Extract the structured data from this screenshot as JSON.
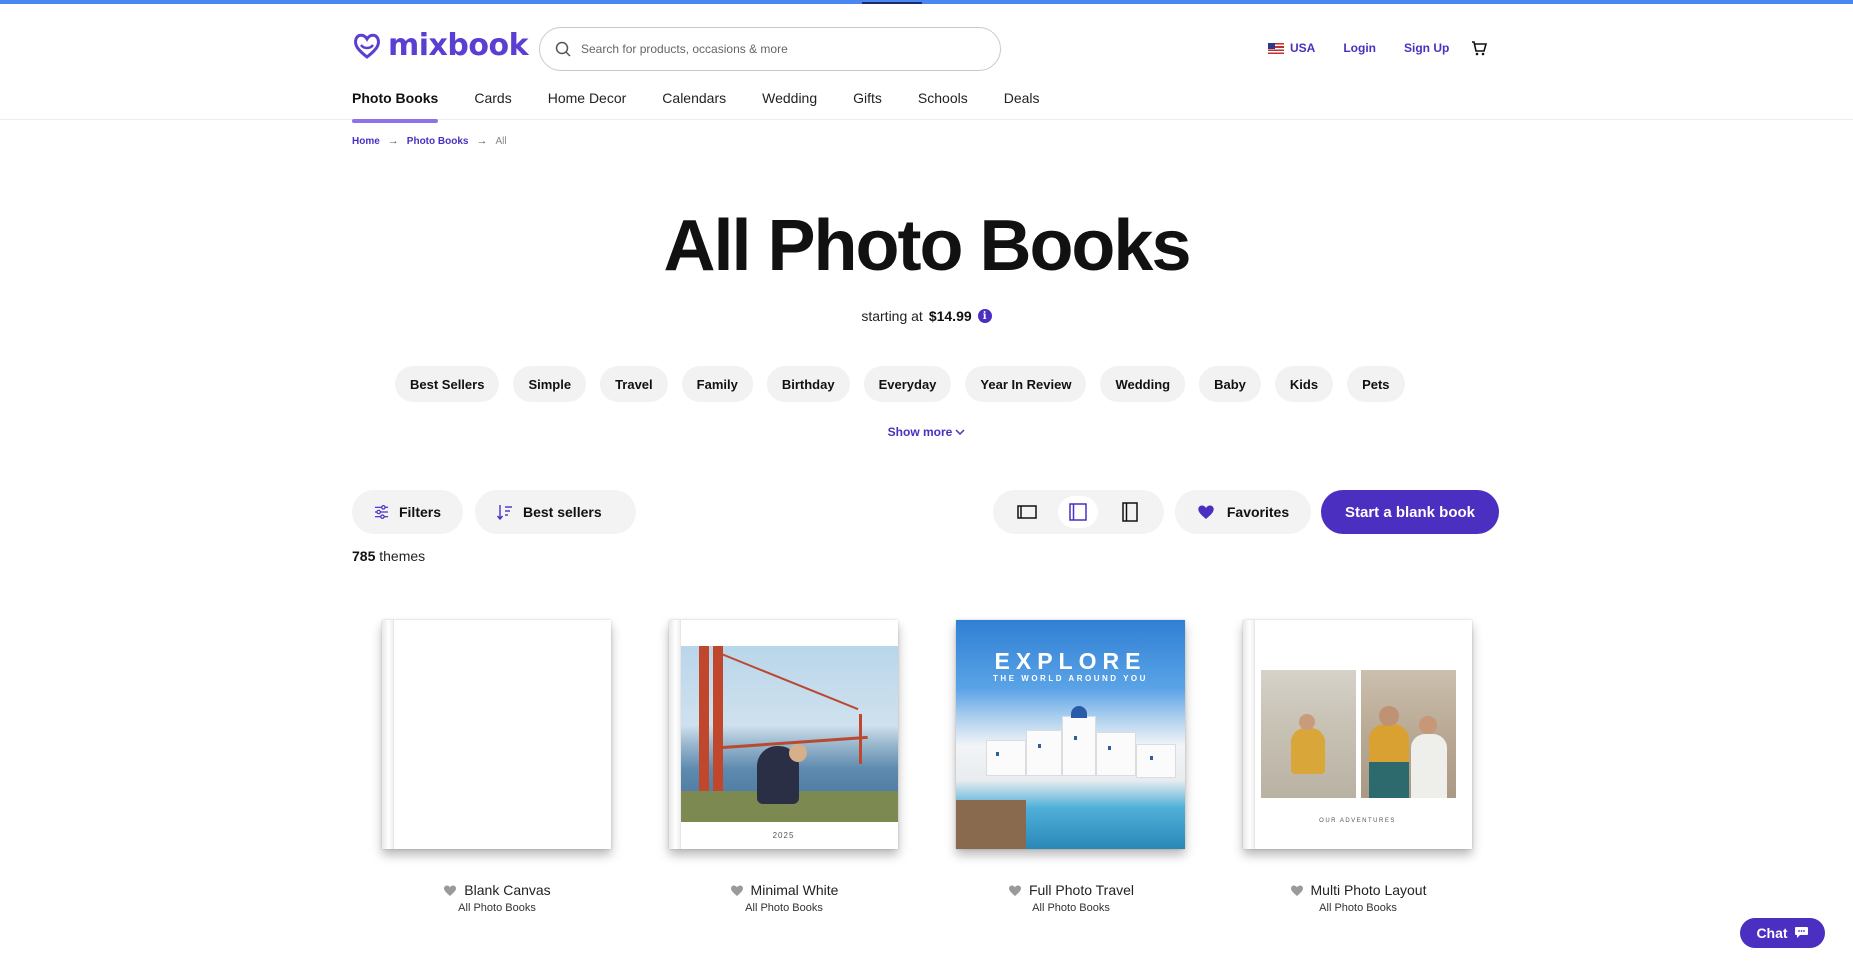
{
  "brand": {
    "name": "mixbook",
    "color": "#5b3fd3"
  },
  "search": {
    "placeholder": "Search for products, occasions & more"
  },
  "header_links": {
    "country": "USA",
    "login": "Login",
    "signup": "Sign Up"
  },
  "nav": {
    "items": [
      "Photo Books",
      "Cards",
      "Home Decor",
      "Calendars",
      "Wedding",
      "Gifts",
      "Schools",
      "Deals"
    ],
    "active": "Photo Books"
  },
  "breadcrumb": {
    "home": "Home",
    "section": "Photo Books",
    "current": "All"
  },
  "page": {
    "title": "All Photo Books",
    "starting_text": "starting at",
    "starting_price": "$14.99"
  },
  "categories": [
    "Best Sellers",
    "Simple",
    "Travel",
    "Family",
    "Birthday",
    "Everyday",
    "Year In Review",
    "Wedding",
    "Baby",
    "Kids",
    "Pets"
  ],
  "show_more": "Show more",
  "toolbar": {
    "filters": "Filters",
    "sort": "Best sellers",
    "favorites": "Favorites",
    "blank_book": "Start a blank book",
    "active_view": "medium"
  },
  "results": {
    "count": "785",
    "label": "themes"
  },
  "products": [
    {
      "name": "Blank Canvas",
      "category": "All Photo Books"
    },
    {
      "name": "Minimal White",
      "category": "All Photo Books",
      "cover_text": "2025"
    },
    {
      "name": "Full Photo Travel",
      "category": "All Photo Books",
      "cover_title": "EXPLORE",
      "cover_subtitle": "THE WORLD AROUND YOU"
    },
    {
      "name": "Multi Photo Layout",
      "category": "All Photo Books",
      "cover_text": "OUR ADVENTURES"
    }
  ],
  "chat": {
    "label": "Chat"
  },
  "colors": {
    "accent": "#4b2fc0",
    "chip_bg": "#f2f2f2",
    "top_bar": "#4a86f0"
  }
}
